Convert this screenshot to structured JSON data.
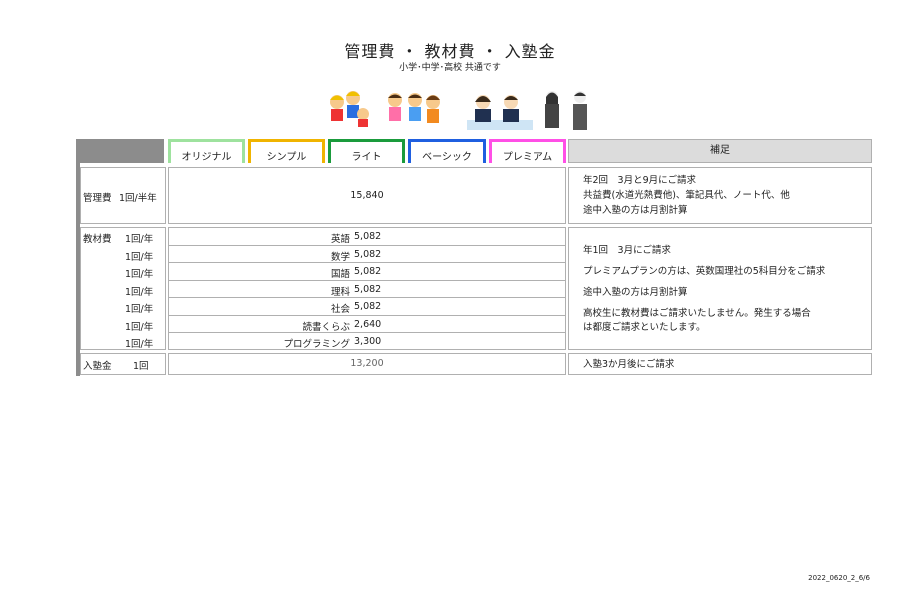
{
  "header": {
    "title": "管理費 ・ 教材費 ・ 入塾金",
    "subtitle": "小学･中学･高校 共通です"
  },
  "illustrations": [
    "kids-group-icon",
    "middle-school-students-icon",
    "high-school-students-icon"
  ],
  "plans": [
    {
      "label": "オリジナル",
      "color": "#9ee29e"
    },
    {
      "label": "シンプル",
      "color": "#f0b400"
    },
    {
      "label": "ライト",
      "color": "#1a9b3c"
    },
    {
      "label": "ベーシック",
      "color": "#1f5fe0"
    },
    {
      "label": "プレミアム",
      "color": "#ff4fe6"
    }
  ],
  "hosoku_header": "補足",
  "kanri": {
    "label": "管理費",
    "freq": "1回/半年",
    "value": "15,840",
    "notes": [
      "年2回　3月と9月にご請求",
      "共益費(水道光熱費他)、筆記具代、ノート代、他",
      "途中入塾の方は月割計算"
    ]
  },
  "kyozai": {
    "label": "教材費",
    "items": [
      {
        "freq": "1回/年",
        "name": "英語",
        "price": "5,082"
      },
      {
        "freq": "1回/年",
        "name": "数学",
        "price": "5,082"
      },
      {
        "freq": "1回/年",
        "name": "国語",
        "price": "5,082"
      },
      {
        "freq": "1回/年",
        "name": "理科",
        "price": "5,082"
      },
      {
        "freq": "1回/年",
        "name": "社会",
        "price": "5,082"
      },
      {
        "freq": "1回/年",
        "name": "読書くらぶ",
        "price": "2,640"
      },
      {
        "freq": "1回/年",
        "name": "プログラミング",
        "price": "3,300"
      }
    ],
    "notes": [
      "年1回　3月にご請求",
      "プレミアムプランの方は、英数国理社の5科目分をご請求",
      "途中入塾の方は月割計算",
      "高校生に教材費はご請求いたしません。発生する場合",
      "は都度ご請求といたします。"
    ]
  },
  "nyujuku": {
    "label": "入塾金",
    "freq": "1回",
    "value": "13,200",
    "note": "入塾3か月後にご請求"
  },
  "footer": "2022_0620_2_6/6"
}
